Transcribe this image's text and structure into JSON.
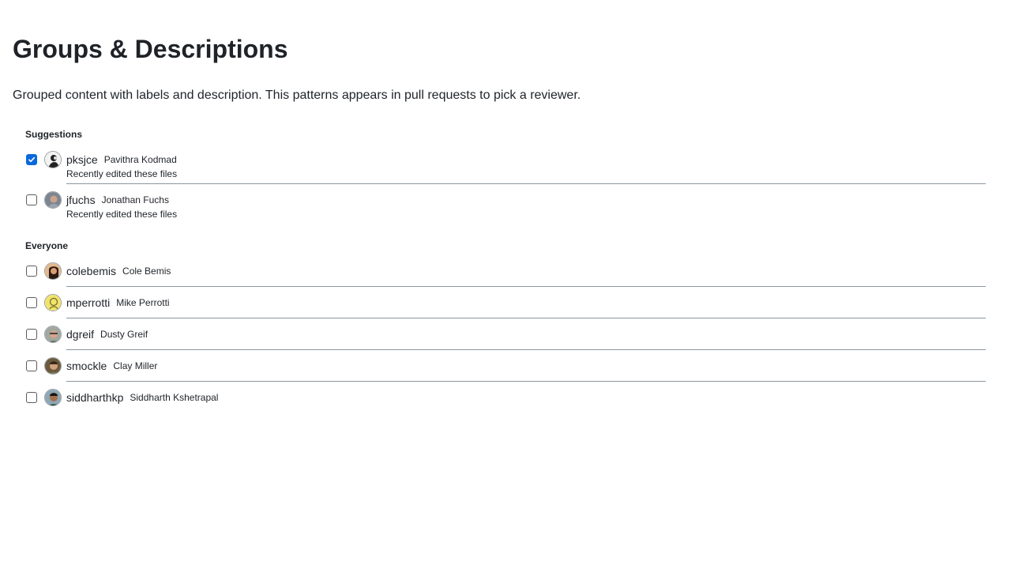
{
  "page": {
    "title": "Groups & Descriptions",
    "intro": "Grouped content with labels and description. This patterns appears in pull requests to pick a reviewer."
  },
  "groups": [
    {
      "label": "Suggestions",
      "items": [
        {
          "login": "pksjce",
          "name": "Pavithra Kodmad",
          "description": "Recently edited these files",
          "checked": true
        },
        {
          "login": "jfuchs",
          "name": "Jonathan Fuchs",
          "description": "Recently edited these files",
          "checked": false
        }
      ]
    },
    {
      "label": "Everyone",
      "items": [
        {
          "login": "colebemis",
          "name": "Cole Bemis",
          "checked": false
        },
        {
          "login": "mperrotti",
          "name": "Mike Perrotti",
          "checked": false
        },
        {
          "login": "dgreif",
          "name": "Dusty Greif",
          "checked": false
        },
        {
          "login": "smockle",
          "name": "Clay Miller",
          "checked": false
        },
        {
          "login": "siddharthkp",
          "name": "Siddharth Kshetrapal",
          "checked": false
        }
      ]
    }
  ],
  "colors": {
    "checkbox_checked": "#0969da",
    "divider": "#8c959f",
    "text": "#1f2328"
  }
}
